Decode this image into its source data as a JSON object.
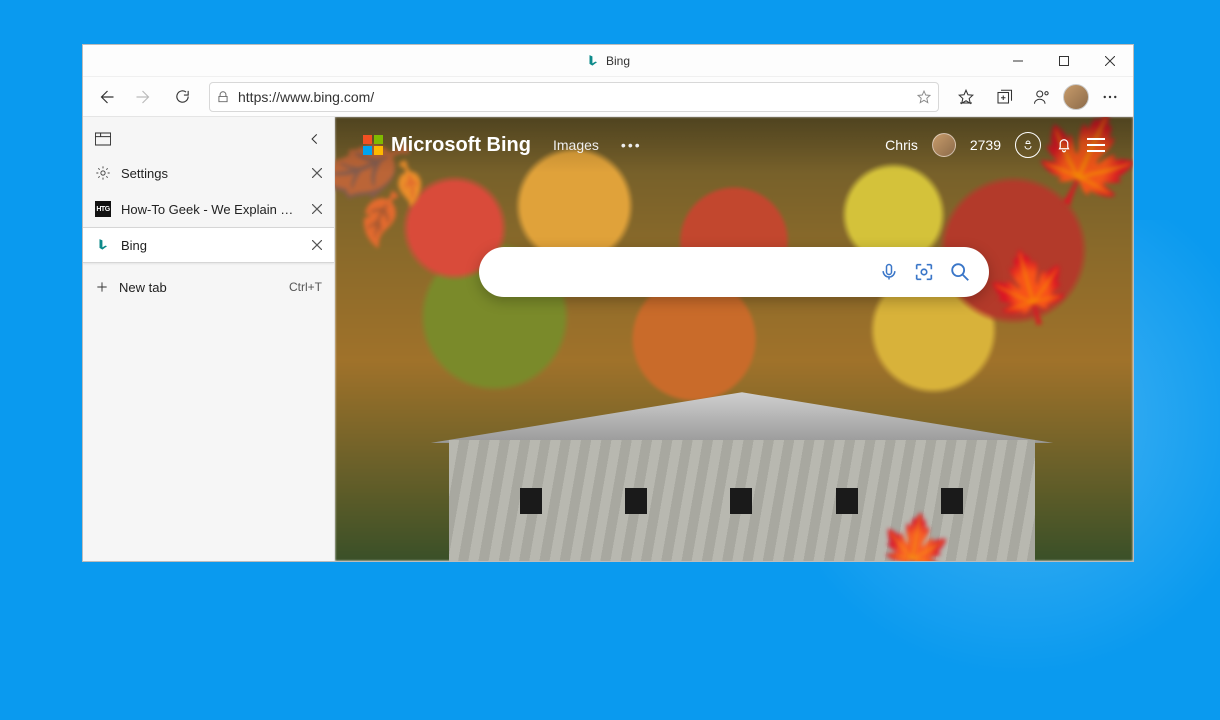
{
  "window": {
    "title": "Bing"
  },
  "toolbar": {
    "url": "https://www.bing.com/"
  },
  "vtabs": {
    "tabs": [
      {
        "label": "Settings",
        "icon": "gear"
      },
      {
        "label": "How-To Geek - We Explain Technology",
        "icon": "htg"
      },
      {
        "label": "Bing",
        "icon": "bing"
      }
    ],
    "newtab_label": "New tab",
    "newtab_shortcut": "Ctrl+T"
  },
  "bing": {
    "logo_text": "Microsoft Bing",
    "nav_images": "Images",
    "user_name": "Chris",
    "rewards_points": "2739",
    "search_placeholder": ""
  }
}
